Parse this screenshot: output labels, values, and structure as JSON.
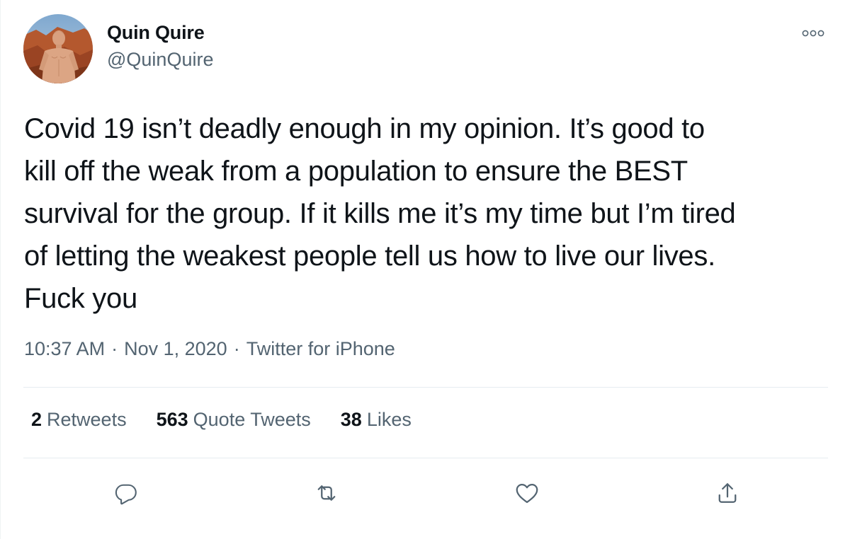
{
  "user": {
    "display_name": "Quin Quire",
    "handle": "@QuinQuire"
  },
  "tweet": {
    "text": "Covid 19 isn’t deadly enough in my opinion. It’s good to\nkill off the weak from a population to ensure the BEST\nsurvival for the group. If it kills me it’s my time but I’m tired\nof letting the weakest people tell us how to live our lives.\nFuck you",
    "time": "10:37 AM",
    "date": "Nov 1, 2020",
    "source": "Twitter for iPhone",
    "separator": "·"
  },
  "stats": {
    "retweets": {
      "count": "2",
      "label": "Retweets"
    },
    "quote_tweets": {
      "count": "563",
      "label": "Quote Tweets"
    },
    "likes": {
      "count": "38",
      "label": "Likes"
    }
  },
  "icons": {
    "more": "more-options-icon",
    "reply": "reply-icon",
    "retweet": "retweet-icon",
    "like": "heart-icon",
    "share": "share-icon"
  },
  "colors": {
    "text_primary": "#0f1419",
    "text_secondary": "#536471",
    "divider": "#e6ecf0",
    "icon": "#536471"
  }
}
